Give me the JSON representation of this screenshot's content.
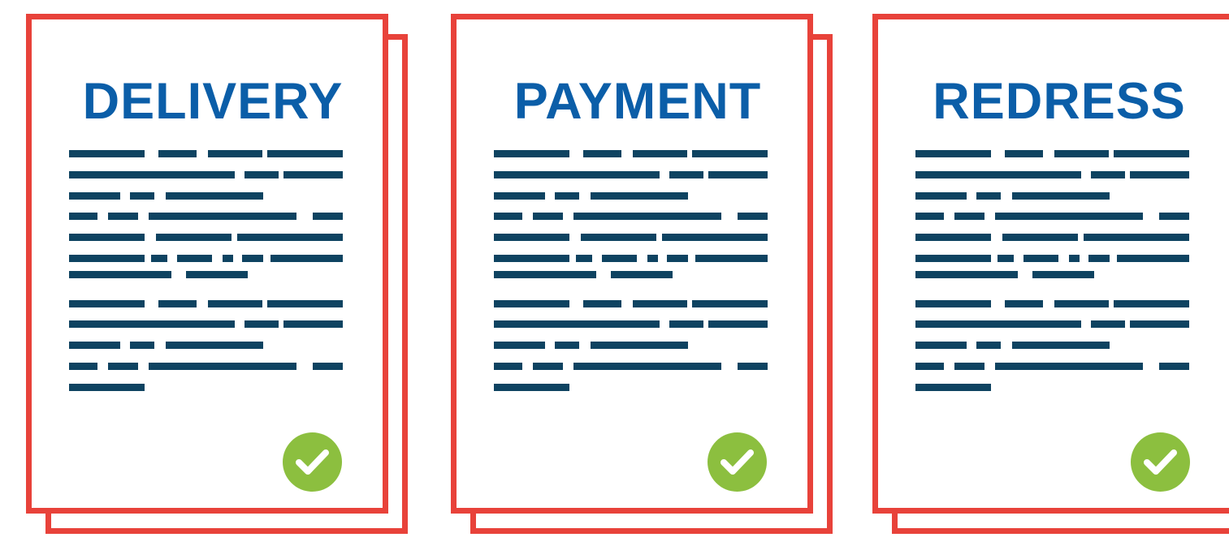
{
  "colors": {
    "border": "#e8423a",
    "title": "#0b5ea8",
    "text_line": "#0e4361",
    "check": "#8cbf3f"
  },
  "documents": [
    {
      "title": "DELIVERY",
      "icon": "checkmark-icon"
    },
    {
      "title": "PAYMENT",
      "icon": "checkmark-icon"
    },
    {
      "title": "REDRESS",
      "icon": "checkmark-icon"
    }
  ]
}
